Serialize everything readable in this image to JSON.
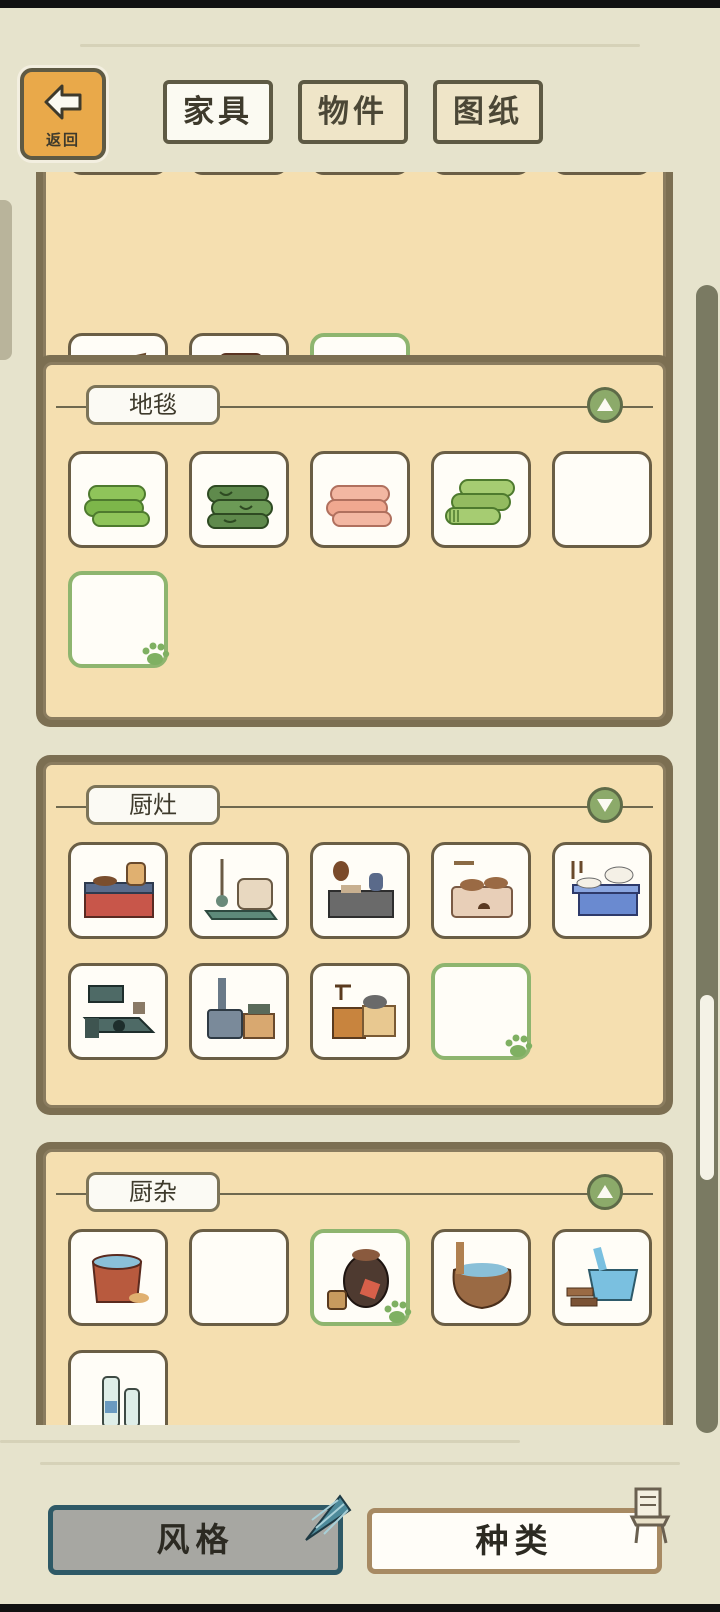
{
  "header": {
    "back_label": "返回",
    "tabs": [
      {
        "label": "家具",
        "active": true
      },
      {
        "label": "物件",
        "active": false
      },
      {
        "label": "图纸",
        "active": false
      }
    ]
  },
  "sections": [
    {
      "title": "",
      "items": [
        "recliner-chair",
        "orange-armchair",
        "empty-selected"
      ]
    },
    {
      "title": "地毯",
      "items": [
        "green-rolled-rug",
        "patterned-green-rug",
        "pink-rolled-rug",
        "striped-green-rug",
        "empty",
        "empty-selected"
      ]
    },
    {
      "title": "厨灶",
      "items": [
        "brick-stove",
        "tool-stove",
        "coffee-stove",
        "clay-oven",
        "blue-cabinet-stove",
        "dark-grill-stove",
        "iron-wood-stove",
        "wooden-stove",
        "empty-selected"
      ]
    },
    {
      "title": "厨杂",
      "items": [
        "soup-pot",
        "empty",
        "pickle-jar",
        "water-urn",
        "wash-basin",
        "glass-bottles"
      ]
    }
  ],
  "footer": {
    "style_label": "风格",
    "kind_label": "种类"
  },
  "colors": {
    "background": "#e6e3cc",
    "panel_fill": "#f5dfb0",
    "panel_border": "#7c6f52",
    "accent_green": "#8caa6a",
    "back_button": "#e9a94a",
    "style_button_border": "#2e5966"
  },
  "icons": [
    "back-arrow-icon",
    "collapse-up-icon",
    "paw-print-icon",
    "shell-icon",
    "chair-icon"
  ]
}
